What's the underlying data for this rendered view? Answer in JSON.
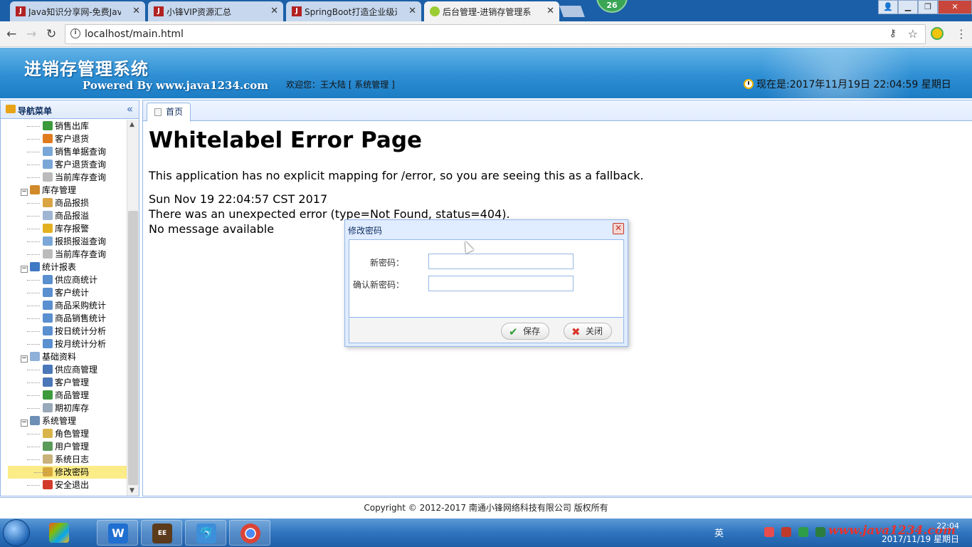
{
  "browser": {
    "tabs": [
      {
        "title": "Java知识分享网-免费Jav",
        "active": false,
        "icon": "java1234-favicon"
      },
      {
        "title": "小锋VIP资源汇总",
        "active": false,
        "icon": "java1234-favicon"
      },
      {
        "title": "SpringBoot打造企业级进",
        "active": false,
        "icon": "java1234-favicon"
      },
      {
        "title": "后台管理-进销存管理系",
        "active": true,
        "icon": "leaf-favicon"
      }
    ],
    "badge": "26",
    "url": "localhost/main.html",
    "window_controls": {
      "min": "▁",
      "max": "❐",
      "close": "✕"
    }
  },
  "header": {
    "app_title": "进销存管理系统",
    "powered_by": "Powered By www.java1234.com",
    "welcome": "欢迎您：王大陆 [ 系统管理 ]",
    "clock": "现在是:2017年11月19日 22:04:59 星期日"
  },
  "sidebar": {
    "title": "导航菜单",
    "collapse": "«",
    "items": [
      {
        "label": "销售出库",
        "kind": "child",
        "icon": "arrow-out-icon",
        "color": "#3c9a3c"
      },
      {
        "label": "客户退货",
        "kind": "child",
        "icon": "arrow-back-icon",
        "color": "#e07b1d"
      },
      {
        "label": "销售单据查询",
        "kind": "child",
        "icon": "search-doc-icon",
        "color": "#7aa7d8"
      },
      {
        "label": "客户退货查询",
        "kind": "child",
        "icon": "search-doc-icon",
        "color": "#7aa7d8"
      },
      {
        "label": "当前库存查询",
        "kind": "child",
        "icon": "doc-icon",
        "color": "#bbbbbb"
      },
      {
        "label": "库存管理",
        "kind": "group",
        "icon": "box-icon",
        "color": "#d08a2a"
      },
      {
        "label": "商品报损",
        "kind": "child",
        "icon": "damage-icon",
        "color": "#d9a441"
      },
      {
        "label": "商品报溢",
        "kind": "child",
        "icon": "overflow-icon",
        "color": "#9fb6d3"
      },
      {
        "label": "库存报警",
        "kind": "child",
        "icon": "warning-icon",
        "color": "#e3b11f"
      },
      {
        "label": "报损报溢查询",
        "kind": "child",
        "icon": "search-doc-icon",
        "color": "#7aa7d8"
      },
      {
        "label": "当前库存查询",
        "kind": "child",
        "icon": "doc-icon",
        "color": "#bbbbbb"
      },
      {
        "label": "统计报表",
        "kind": "group",
        "icon": "bar-chart-icon",
        "color": "#3f78c4"
      },
      {
        "label": "供应商统计",
        "kind": "child",
        "icon": "chart-icon",
        "color": "#5a8fd0"
      },
      {
        "label": "客户统计",
        "kind": "child",
        "icon": "chart-icon",
        "color": "#5a8fd0"
      },
      {
        "label": "商品采购统计",
        "kind": "child",
        "icon": "chart-icon",
        "color": "#5a8fd0"
      },
      {
        "label": "商品销售统计",
        "kind": "child",
        "icon": "chart-icon",
        "color": "#5a8fd0"
      },
      {
        "label": "按日统计分析",
        "kind": "child",
        "icon": "chart-icon",
        "color": "#5a8fd0"
      },
      {
        "label": "按月统计分析",
        "kind": "child",
        "icon": "chart-icon",
        "color": "#5a8fd0"
      },
      {
        "label": "基础资料",
        "kind": "group",
        "icon": "data-icon",
        "color": "#8fb0d8"
      },
      {
        "label": "供应商管理",
        "kind": "child",
        "icon": "user-icon",
        "color": "#4a78b8"
      },
      {
        "label": "客户管理",
        "kind": "child",
        "icon": "user-icon",
        "color": "#4a78b8"
      },
      {
        "label": "商品管理",
        "kind": "child",
        "icon": "tree-icon",
        "color": "#3c9a3c"
      },
      {
        "label": "期初库存",
        "kind": "child",
        "icon": "stock-icon",
        "color": "#9aa9b9"
      },
      {
        "label": "系统管理",
        "kind": "group",
        "icon": "computer-icon",
        "color": "#6d8fb6"
      },
      {
        "label": "角色管理",
        "kind": "child",
        "icon": "role-icon",
        "color": "#d9b44a"
      },
      {
        "label": "用户管理",
        "kind": "child",
        "icon": "users-icon",
        "color": "#5a9b5a"
      },
      {
        "label": "系统日志",
        "kind": "child",
        "icon": "log-icon",
        "color": "#c9b17a"
      },
      {
        "label": "修改密码",
        "kind": "child",
        "icon": "key-icon",
        "color": "#d6a83c",
        "selected": true
      },
      {
        "label": "安全退出",
        "kind": "child",
        "icon": "exit-icon",
        "color": "#d33a2c"
      }
    ]
  },
  "main": {
    "tab_label": "首页",
    "error_title": "Whitelabel Error Page",
    "error_msg": "This application has no explicit mapping for /error, so you are seeing this as a fallback.",
    "error_time": "Sun Nov 19 22:04:57 CST 2017",
    "error_detail": "There was an unexpected error (type=Not Found, status=404).",
    "error_nomsg": "No message available"
  },
  "dialog": {
    "title": "修改密码",
    "close": "✕",
    "new_password_label": "新密码：",
    "confirm_password_label": "确认新密码：",
    "new_password_value": "",
    "confirm_password_value": "",
    "save_label": "保存",
    "close_label": "关闭"
  },
  "footer": {
    "copyright": "Copyright © 2012-2017 南通小锋网络科技有限公司 版权所有"
  },
  "taskbar": {
    "ime": "英",
    "watermark": "www.java1234.com",
    "time": "22:04",
    "date": "2017/11/19 星期日"
  }
}
